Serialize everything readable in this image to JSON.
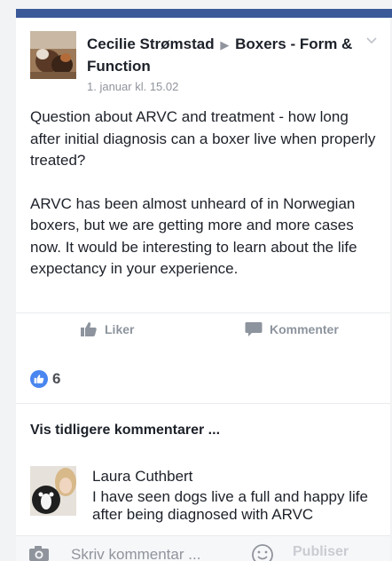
{
  "post": {
    "author": "Cecilie Strømstad",
    "separator": "▶",
    "group": "Boxers - Form & Function",
    "timestamp": "1. januar kl. 15.02",
    "paragraphs": [
      "Question about ARVC and treatment - how long after initial diagnosis can a boxer live when properly treated?",
      "ARVC has been almost unheard of in Norwegian boxers, but we are getting more and more cases now. It would be interesting to learn about the life expectancy in your experience."
    ]
  },
  "actions": {
    "like_label": "Liker",
    "comment_label": "Kommenter"
  },
  "reactions": {
    "count": "6",
    "icon": "like-icon",
    "color": "#4a86f0"
  },
  "comments": {
    "show_previous_label": "Vis tidligere kommentarer ...",
    "items": [
      {
        "author": "Laura Cuthbert",
        "text": "I have seen dogs live a full and happy life after being diagnosed with ARVC"
      }
    ]
  },
  "composer": {
    "placeholder": "Skriv kommentar ...",
    "publish_label": "Publiser"
  },
  "colors": {
    "brand": "#3b5998",
    "text": "#1d2129",
    "muted": "#90949c"
  }
}
